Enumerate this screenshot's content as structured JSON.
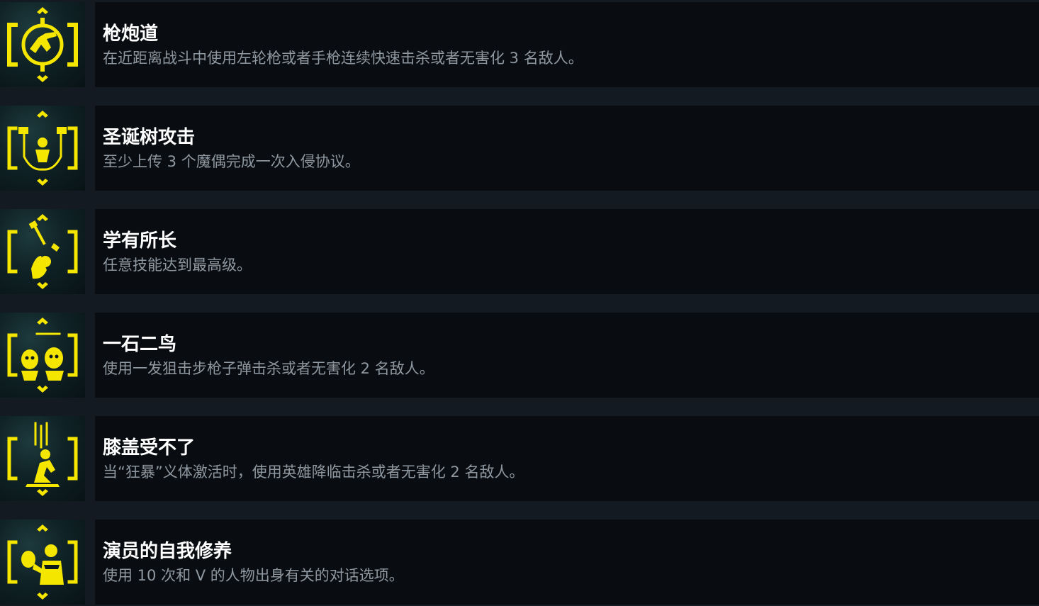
{
  "accent_color": "#f5e600",
  "achievements": [
    {
      "icon": "gunslinger-emblem-icon",
      "title": "枪炮道",
      "description": "在近距离战斗中使用左轮枪或者手枪连续快速击杀或者无害化 3 名敌人。"
    },
    {
      "icon": "christmas-tree-attack-emblem-icon",
      "title": "圣诞树攻击",
      "description": "至少上传 3 个魔偶完成一次入侵协议。"
    },
    {
      "icon": "specialist-emblem-icon",
      "title": "学有所长",
      "description": "任意技能达到最高级。"
    },
    {
      "icon": "two-birds-one-stone-emblem-icon",
      "title": "一石二鸟",
      "description": "使用一发狙击步枪子弹击杀或者无害化 2 名敌人。"
    },
    {
      "icon": "knee-breaker-emblem-icon",
      "title": "膝盖受不了",
      "description": "当“狂暴”义体激活时，使用英雄降临击杀或者无害化 2 名敌人。"
    },
    {
      "icon": "actor-self-cultivation-emblem-icon",
      "title": "演员的自我修养",
      "description": "使用 10 次和 V 的人物出身有关的对话选项。"
    }
  ]
}
